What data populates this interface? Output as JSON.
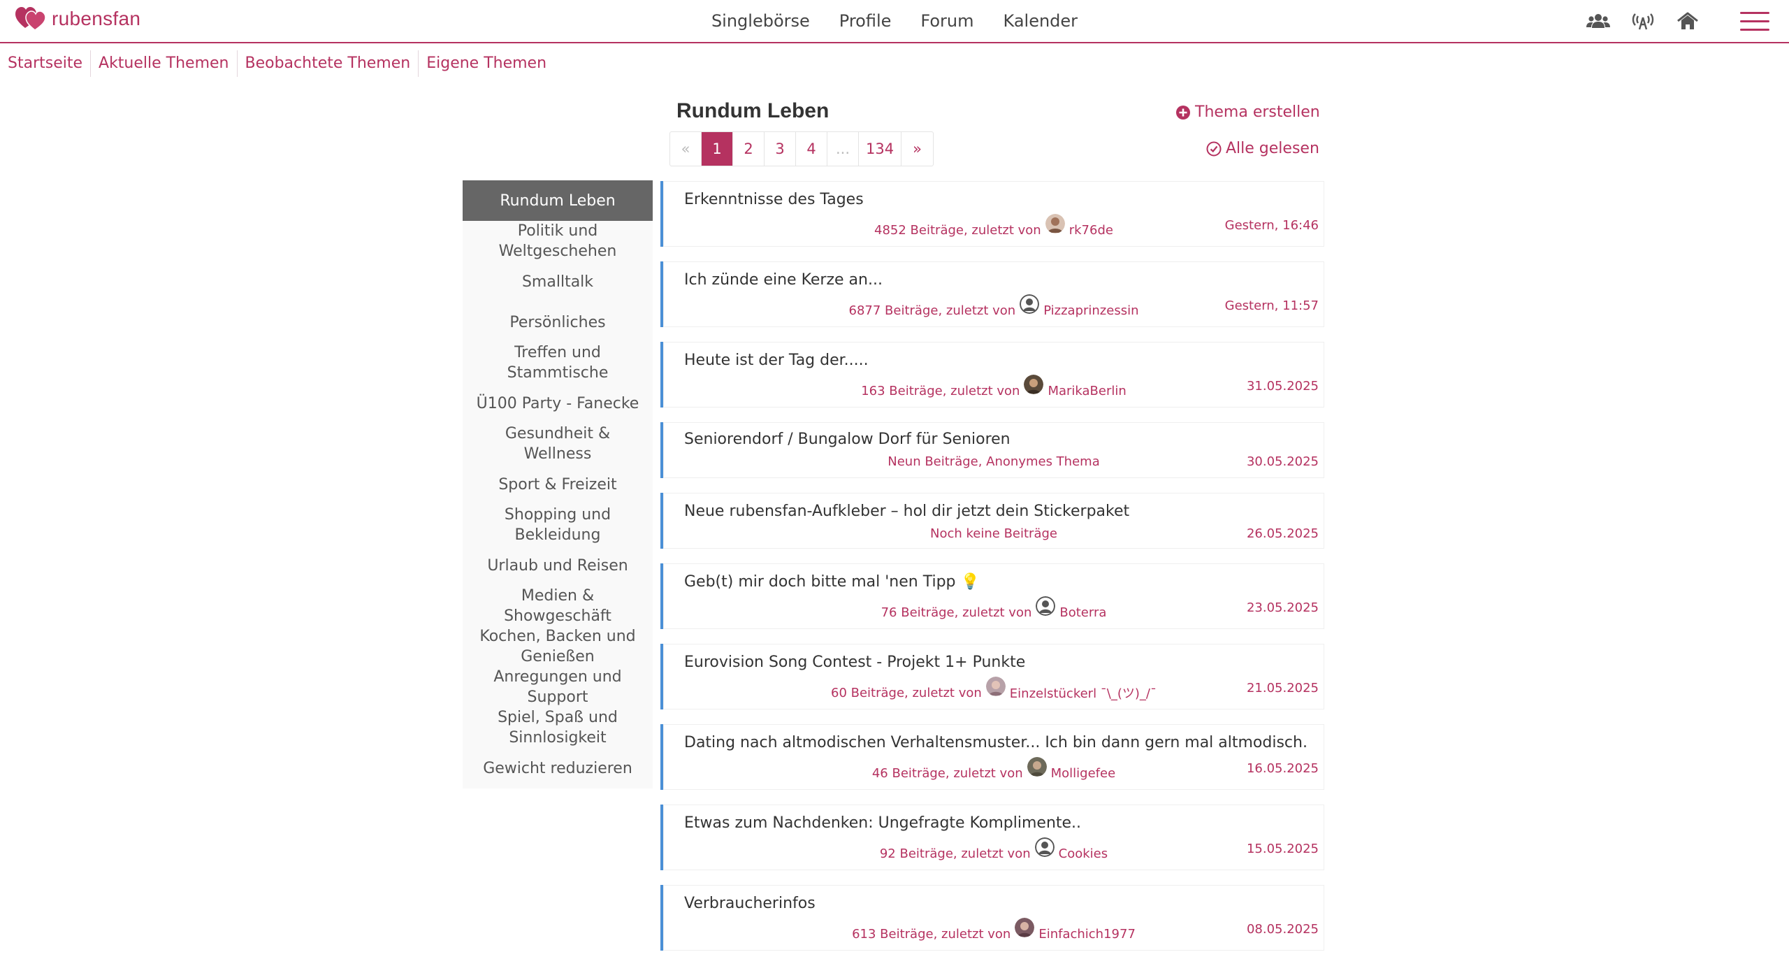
{
  "brand": {
    "name": "rubensfan",
    "color": "#b53260"
  },
  "main_nav": [
    "Singlebörse",
    "Profile",
    "Forum",
    "Kalender"
  ],
  "top_icons": [
    "users-icon",
    "broadcast-icon",
    "home-icon",
    "menu-icon"
  ],
  "sub_nav": [
    "Startseite",
    "Aktuelle Themen",
    "Beobachtete Themen",
    "Eigene Themen"
  ],
  "forum": {
    "title": "Rundum Leben",
    "create_label": "Thema erstellen",
    "read_label": "Alle gelesen"
  },
  "pagination": {
    "prev": "«",
    "pages": [
      "1",
      "2",
      "3",
      "4",
      "...",
      "134"
    ],
    "next": "»",
    "current": "1"
  },
  "sidebar": {
    "items": [
      "Rundum Leben",
      "Politik und Weltgeschehen",
      "Smalltalk",
      "Persönliches",
      "Treffen und Stammtische",
      "Ü100 Party - Fanecke",
      "Gesundheit & Wellness",
      "Sport & Freizeit",
      "Shopping und Bekleidung",
      "Urlaub und Reisen",
      "Medien & Showgeschäft",
      "Kochen, Backen und Genießen",
      "Anregungen und Support",
      "Spiel, Spaß und Sinnlosigkeit",
      "Gewicht reduzieren"
    ],
    "active": "Rundum Leben"
  },
  "topics": [
    {
      "title": "Erkenntnisse des Tages",
      "meta": "4852 Beiträge, zuletzt von",
      "user": "rk76de",
      "date": "Gestern, 16:46"
    },
    {
      "title": "Ich zünde eine Kerze an...",
      "meta": "6877 Beiträge, zuletzt von",
      "user": "Pizzaprinzessin",
      "date": "Gestern, 11:57"
    },
    {
      "title": "Heute ist der Tag der.....",
      "meta": "163 Beiträge, zuletzt von",
      "user": "MarikaBerlin",
      "date": "31.05.2025"
    },
    {
      "title": "Seniorendorf / Bungalow Dorf für Senioren",
      "meta": "Neun Beiträge, Anonymes Thema",
      "user": "",
      "date": "30.05.2025"
    },
    {
      "title": "Neue rubensfan-Aufkleber – hol dir jetzt dein Stickerpaket",
      "meta": "Noch keine Beiträge",
      "user": "",
      "date": "26.05.2025"
    },
    {
      "title": "Geb(t) mir doch bitte mal 'nen Tipp 💡",
      "meta": "76 Beiträge, zuletzt von",
      "user": "Boterra",
      "date": "23.05.2025"
    },
    {
      "title": "Eurovision Song Contest - Projekt 1+ Punkte",
      "meta": "60 Beiträge, zuletzt von",
      "user": "Einzelstückerl ¯\\_(ツ)_/¯",
      "date": "21.05.2025"
    },
    {
      "title": "Dating nach altmodischen Verhaltensmuster... Ich bin dann gern mal altmodisch.",
      "meta": "46 Beiträge, zuletzt von",
      "user": "Molligefee",
      "date": "16.05.2025"
    },
    {
      "title": "Etwas zum Nachdenken: Ungefragte Komplimente..",
      "meta": "92 Beiträge, zuletzt von",
      "user": "Cookies",
      "date": "15.05.2025"
    },
    {
      "title": "Verbraucherinfos",
      "meta": "613 Beiträge, zuletzt von",
      "user": "Einfachich1977",
      "date": "08.05.2025"
    }
  ]
}
